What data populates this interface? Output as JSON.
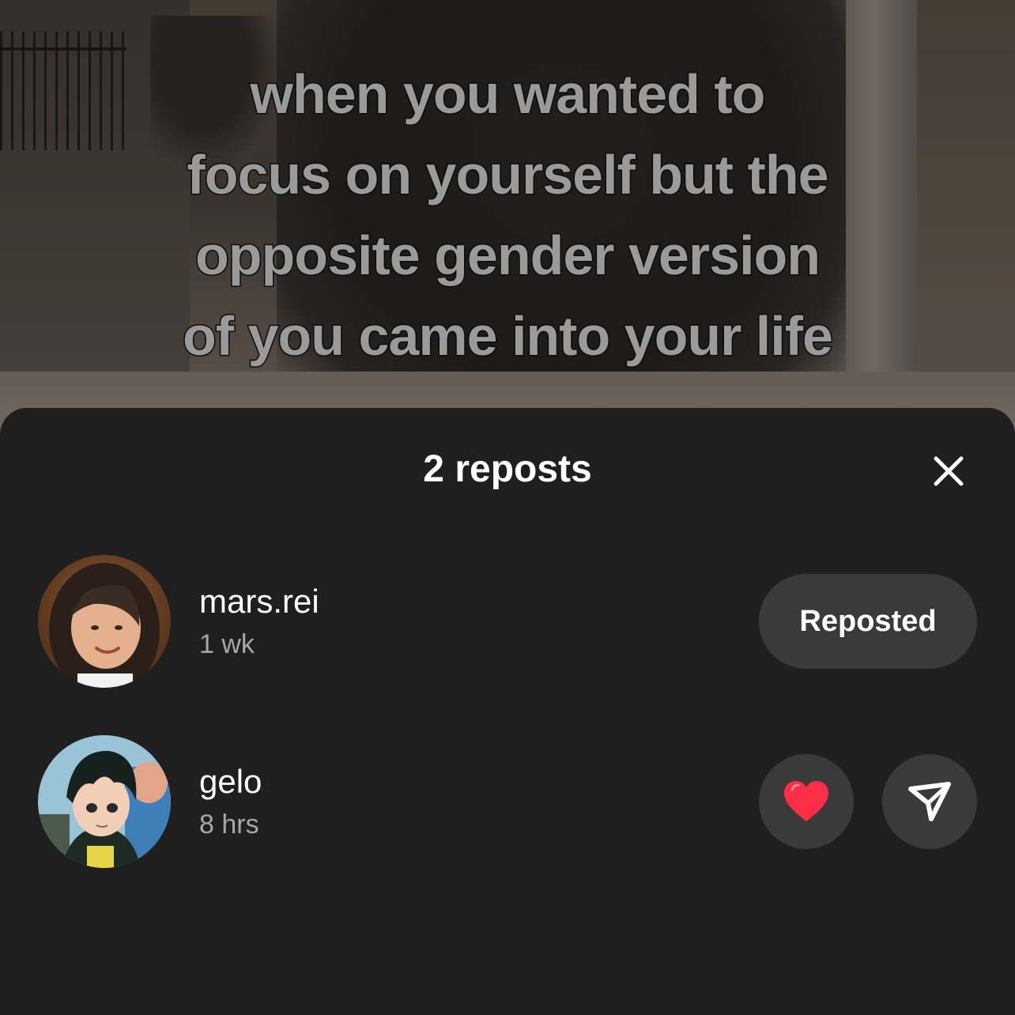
{
  "video": {
    "caption_lines": [
      "when you wanted to",
      "focus on yourself but the",
      "opposite gender version",
      "of you came into your life"
    ]
  },
  "sheet": {
    "title": "2 reposts",
    "close_icon": "close-icon"
  },
  "reposts": [
    {
      "username": "mars.rei",
      "time": "1 wk",
      "action_label": "Reposted"
    },
    {
      "username": "gelo",
      "time": "8 hrs",
      "actions": [
        "heart-icon",
        "send-icon"
      ]
    }
  ],
  "colors": {
    "sheet_bg": "#1f1f1f",
    "button_bg": "#3a3a3a",
    "heart": "#ff2d47",
    "secondary_text": "#a7a7a7"
  }
}
